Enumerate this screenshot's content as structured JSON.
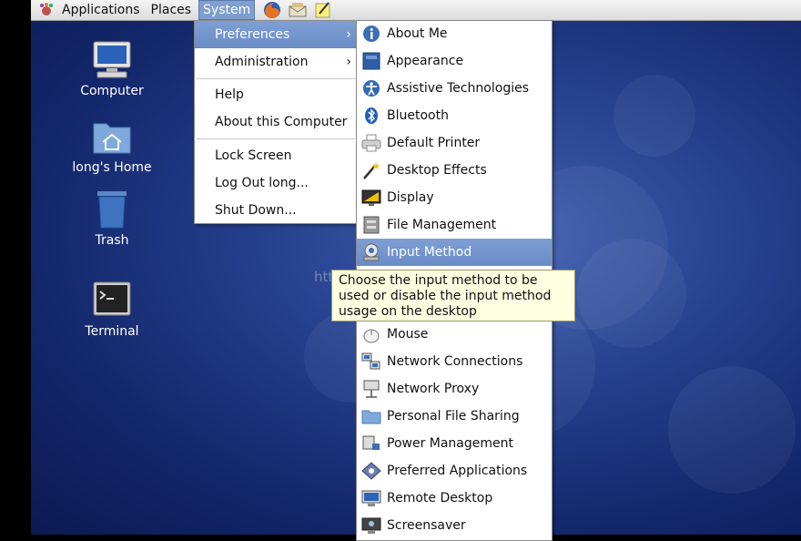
{
  "panel": {
    "menus": [
      "Applications",
      "Places",
      "System"
    ],
    "launchers": [
      "firefox-icon",
      "email-client-icon",
      "notes-editor-icon"
    ]
  },
  "desktop": {
    "icons": [
      {
        "label": "Computer",
        "icon": "computer-icon"
      },
      {
        "label": "long's Home",
        "icon": "home-folder-icon"
      },
      {
        "label": "Trash",
        "icon": "trash-icon"
      },
      {
        "label": "Terminal",
        "icon": "terminal-icon"
      }
    ],
    "watermark": "http"
  },
  "system_menu": {
    "items": [
      "Preferences",
      "Administration",
      "Help",
      "About this Computer",
      "Lock Screen",
      "Log Out long...",
      "Shut Down..."
    ],
    "submenu_arrow": "›"
  },
  "preferences_menu": {
    "items": [
      {
        "label": "About Me",
        "icon": "about-me-icon"
      },
      {
        "label": "Appearance",
        "icon": "appearance-icon"
      },
      {
        "label": "Assistive Technologies",
        "icon": "accessibility-icon"
      },
      {
        "label": "Bluetooth",
        "icon": "bluetooth-icon"
      },
      {
        "label": "Default Printer",
        "icon": "printer-icon"
      },
      {
        "label": "Desktop Effects",
        "icon": "desktop-effects-icon"
      },
      {
        "label": "Display",
        "icon": "display-icon"
      },
      {
        "label": "File Management",
        "icon": "file-management-icon"
      },
      {
        "label": "Input Method",
        "icon": "input-method-icon"
      },
      {
        "label": "Mouse",
        "icon": "mouse-icon"
      },
      {
        "label": "Network Connections",
        "icon": "network-connections-icon"
      },
      {
        "label": "Network Proxy",
        "icon": "network-proxy-icon"
      },
      {
        "label": "Personal File Sharing",
        "icon": "file-sharing-icon"
      },
      {
        "label": "Power Management",
        "icon": "power-management-icon"
      },
      {
        "label": "Preferred Applications",
        "icon": "preferred-applications-icon"
      },
      {
        "label": "Remote Desktop",
        "icon": "remote-desktop-icon"
      },
      {
        "label": "Screensaver",
        "icon": "screensaver-icon"
      }
    ],
    "tooltip": "Choose the input method to be used or disable the input method usage on the desktop"
  },
  "colors": {
    "highlight": "#6f90c9",
    "tooltip_bg": "#ffffe1",
    "desktop_bg": "#1e3a86"
  }
}
